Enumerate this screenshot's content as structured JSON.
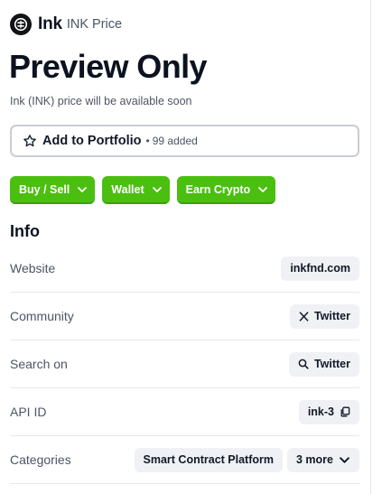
{
  "header": {
    "coin_name": "Ink",
    "coin_subtitle": "INK Price"
  },
  "title": "Preview Only",
  "subtitle": "Ink (INK) price will be available soon",
  "portfolio": {
    "label": "Add to Portfolio",
    "bullet": "•",
    "count": "99 added"
  },
  "actions": [
    {
      "label": "Buy / Sell",
      "icon": "chevron-down-icon"
    },
    {
      "label": "Wallet",
      "icon": "chevron-down-icon"
    },
    {
      "label": "Earn Crypto",
      "icon": "chevron-down-icon"
    }
  ],
  "info": {
    "title": "Info",
    "rows": [
      {
        "key": "Website",
        "value": "inkfnd.com"
      },
      {
        "key": "Community",
        "value": "Twitter",
        "icon": "x-logo-icon"
      },
      {
        "key": "Search on",
        "value": "Twitter",
        "icon": "search-icon"
      },
      {
        "key": "API ID",
        "value": "ink-3",
        "icon": "copy-icon"
      },
      {
        "key": "Categories",
        "value": "Smart Contract Platform",
        "more": "3 more",
        "icon": "chevron-down-icon"
      }
    ]
  },
  "colors": {
    "accent_green": "#4bbf0f",
    "chip_bg": "#eff1f4",
    "text_dark": "#0b1220",
    "text_muted": "#4b5565"
  }
}
